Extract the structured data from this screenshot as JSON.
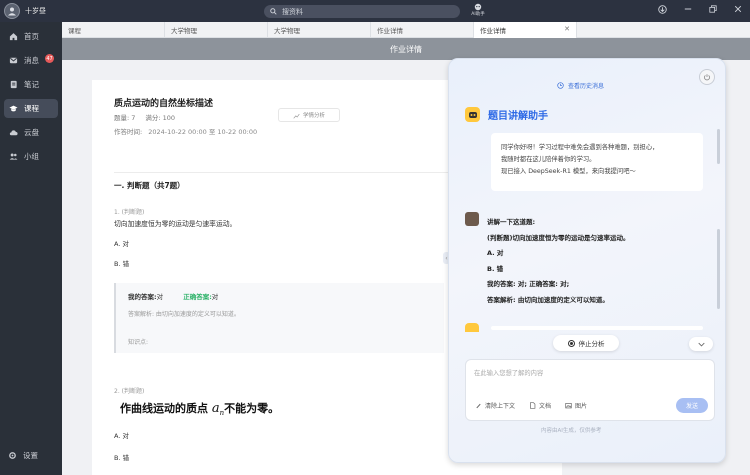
{
  "topbar": {
    "username": "十岁昼",
    "search_placeholder": "搜资料",
    "ai_label": "AI助手"
  },
  "sidebar": {
    "items": [
      {
        "label": "首页",
        "icon": "home-icon"
      },
      {
        "label": "消息",
        "icon": "message-icon",
        "badge": "47"
      },
      {
        "label": "笔记",
        "icon": "note-icon"
      },
      {
        "label": "课程",
        "icon": "course-icon"
      },
      {
        "label": "云盘",
        "icon": "cloud-icon"
      },
      {
        "label": "小组",
        "icon": "group-icon"
      }
    ],
    "settings_label": "设置"
  },
  "tabs": [
    "课程",
    "大学物理",
    "大学物理",
    "作业详情",
    "作业详情"
  ],
  "page_title": "作业详情",
  "homework": {
    "title": "质点运动的自然坐标描述",
    "count": "题量: 7",
    "score": "满分: 100",
    "time_label": "作答时间:",
    "time_value": "2024-10-22 00:00  至  10-22 00:00",
    "analysis_button": "学情分析",
    "section": "一. 判断题（共7题）",
    "q1": {
      "tag": "1. (判断题)",
      "text": "切向加速度恒为零的运动是匀速率运动。",
      "options": [
        "A. 对",
        "B. 错"
      ],
      "my_answer_label": "我的答案:",
      "my_answer": "对",
      "correct_label": "正确答案:",
      "correct": "对",
      "explain": "答案解析: 由切向加速度的定义可以知道。",
      "knowledge": "知识点:"
    },
    "q2": {
      "tag": "2. (判断题)",
      "text_before": "作曲线运动的质点",
      "var": "a",
      "sub": "n",
      "text_after": "不能为零。",
      "options": [
        "A. 对",
        "B. 错"
      ]
    }
  },
  "ai_panel": {
    "history": "查看历史消息",
    "title": "题目讲解助手",
    "welcome": [
      "同学你好呀！学习过程中难免会遇到各种难题，别担心，",
      "我随时都在这儿陪伴着你的学习。",
      "现已接入 DeepSeek-R1 模型，来向我提问吧～"
    ],
    "user_msg": [
      "讲解一下这道题:",
      "(判断题)切向加速度恒为零的运动是匀速率运动。",
      "A. 对",
      "B. 错",
      "我的答案: 对;  正确答案: 对;",
      "答案解析: 由切向加速度的定义可以知道。"
    ],
    "stop": "停止分析",
    "input_placeholder": "在此输入您想了解的内容",
    "tools": [
      "清除上下文",
      "文档",
      "图片"
    ],
    "send": "发送",
    "disclaimer": "内容由AI生成，仅供参考"
  }
}
